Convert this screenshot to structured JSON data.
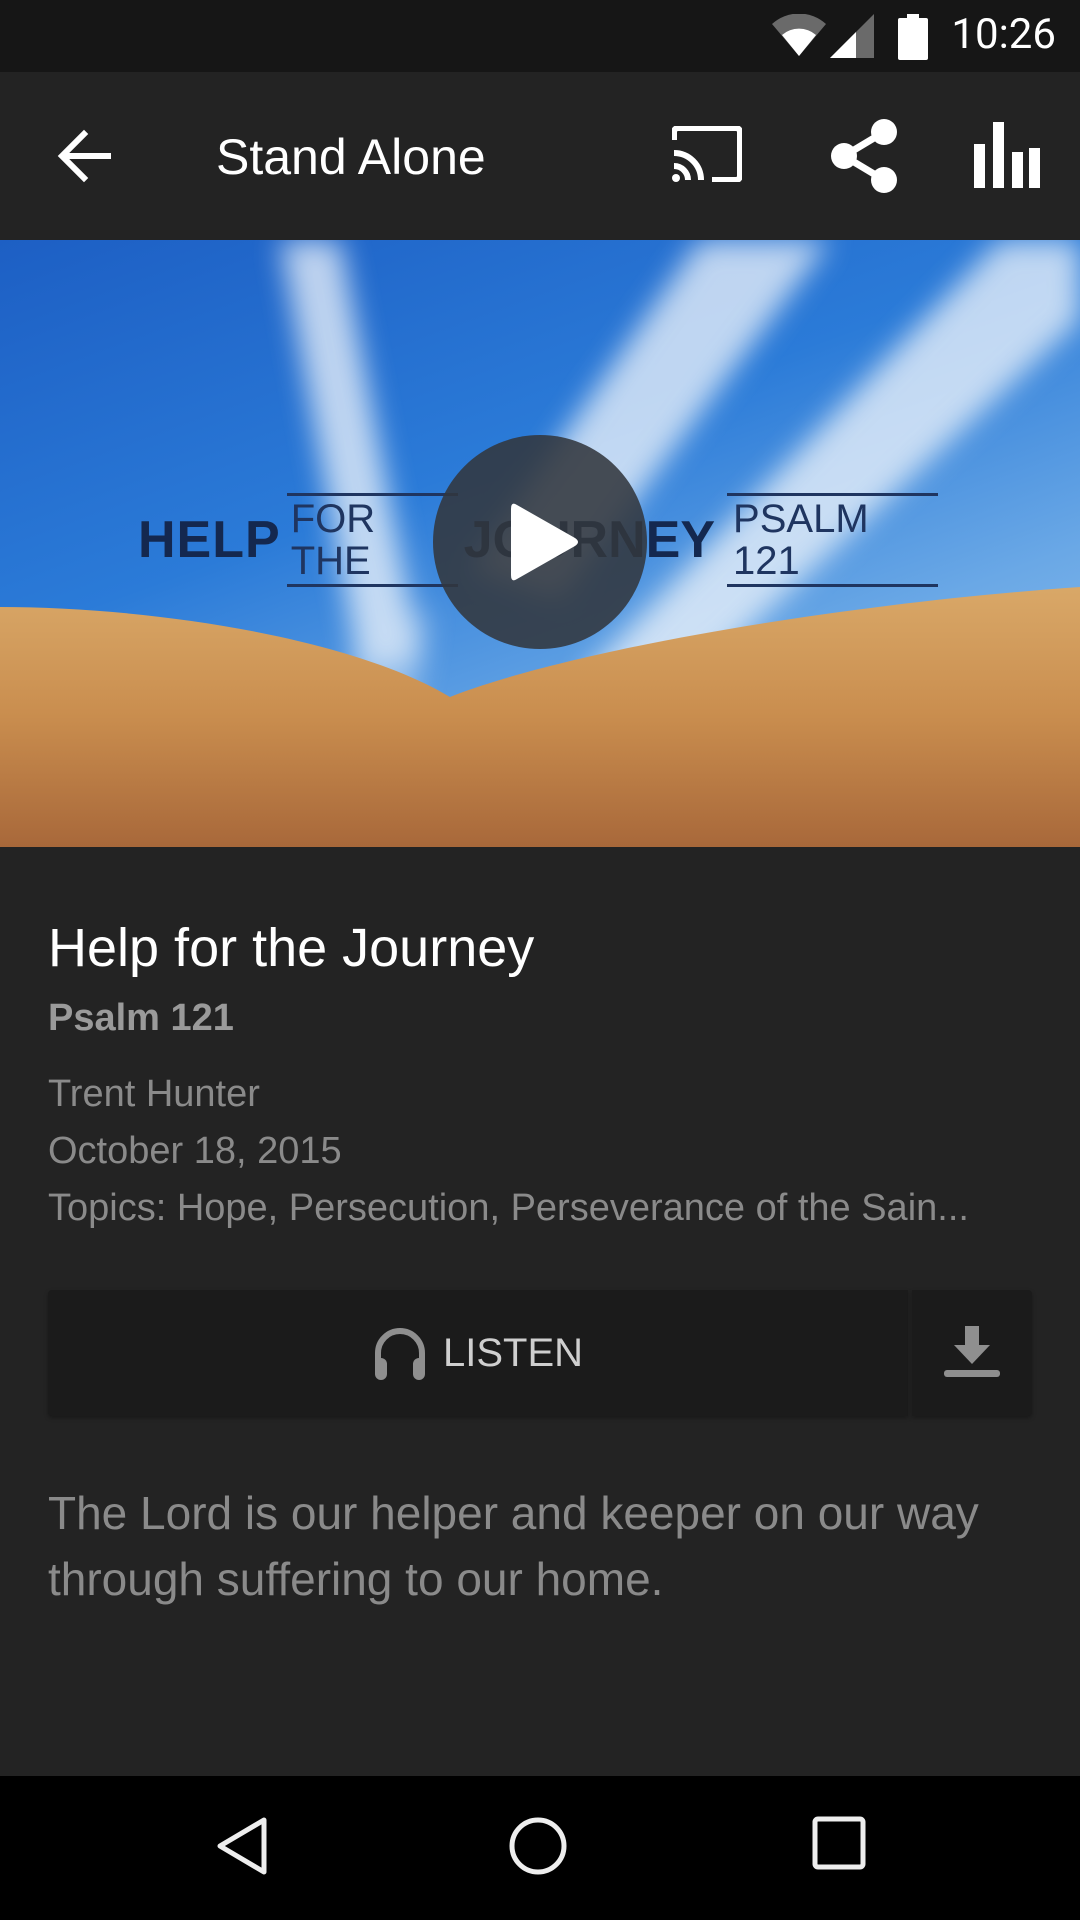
{
  "status_bar": {
    "time": "10:26",
    "icons": [
      "wifi-icon",
      "cell-signal-icon",
      "battery-icon"
    ]
  },
  "app_bar": {
    "title": "Stand Alone",
    "back_icon": "arrow-left-icon",
    "actions": [
      "cast-icon",
      "share-icon",
      "stats-bars-icon"
    ]
  },
  "hero": {
    "banner": {
      "word1": "HELP",
      "word2": "FOR THE",
      "word3": "JOURNEY",
      "word4": "PSALM 121"
    },
    "play_icon": "play-icon"
  },
  "sermon": {
    "title": "Help for the Journey",
    "passage": "Psalm 121",
    "speaker": "Trent Hunter",
    "date": "October 18, 2015",
    "topics": "Topics: Hope, Persecution, Perseverance of the Sain..."
  },
  "actions": {
    "listen_label": "LISTEN",
    "listen_icon": "headphones-icon",
    "download_icon": "download-icon"
  },
  "description": "The Lord is our helper and keeper on our way through suffering to our home.",
  "nav_bar": {
    "buttons": [
      "back-triangle-icon",
      "home-circle-icon",
      "recents-square-icon"
    ]
  },
  "colors": {
    "background": "#232323",
    "status_bar": "#161616",
    "button_bg": "#1b1b1b",
    "secondary_text": "#8a8a8a"
  }
}
